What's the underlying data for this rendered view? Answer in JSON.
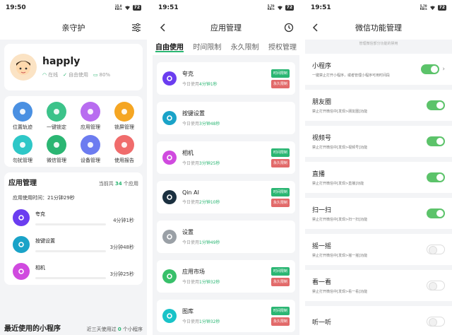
{
  "screen1": {
    "status_time": "19:50",
    "battery": "72",
    "title": "亲守护",
    "profile": {
      "name": "happly",
      "status_online": "在线",
      "status_free": "自由使用",
      "battery_pct": "80%"
    },
    "features": [
      {
        "label": "位置轨迹",
        "color": "#4a90e2"
      },
      {
        "label": "一键锁定",
        "color": "#3cc38a"
      },
      {
        "label": "应用管理",
        "color": "#b86cf0"
      },
      {
        "label": "锁屏管理",
        "color": "#f5a623"
      },
      {
        "label": "勿扰管理",
        "color": "#2ec7c7"
      },
      {
        "label": "微信管理",
        "color": "#2bb673"
      },
      {
        "label": "设备管理",
        "color": "#6c7cf0"
      },
      {
        "label": "使用报告",
        "color": "#f06c6c"
      }
    ],
    "app_section": {
      "title": "应用管理",
      "count_prefix": "当前共",
      "count": "34",
      "count_suffix": "个应用"
    },
    "usage_time": "应用使用时间：21分钟29秒",
    "usage_rows": [
      {
        "name": "夸克",
        "time": "4分钟1秒",
        "color": "#6b3df0"
      },
      {
        "name": "按键设置",
        "time": "3分钟48秒",
        "color": "#1aa3c8"
      },
      {
        "name": "相机",
        "time": "3分钟25秒",
        "color": "#d04adf"
      }
    ],
    "recent": {
      "title": "最近使用的小程序",
      "note_prefix": "近三天使用过",
      "count": "0",
      "note_suffix": "个小程序"
    }
  },
  "screen2": {
    "status_time": "19:51",
    "battery": "72",
    "title": "应用管理",
    "tabs": [
      "自由使用",
      "时间限制",
      "永久限制",
      "授权管理"
    ],
    "buttons": {
      "time_limit": "时间限制",
      "perm_limit": "永久限制"
    },
    "today_prefix": "今日使用",
    "apps": [
      {
        "name": "夸克",
        "use": "4分钟1秒",
        "color": "#6b3df0",
        "btns": true
      },
      {
        "name": "按键设置",
        "use": "3分钟48秒",
        "color": "#1aa3c8",
        "btns": false
      },
      {
        "name": "相机",
        "use": "3分钟25秒",
        "color": "#d04adf",
        "btns": true
      },
      {
        "name": "Qin AI",
        "use": "2分钟10秒",
        "color": "#1b3040",
        "btns": true
      },
      {
        "name": "设置",
        "use": "1分钟49秒",
        "color": "#9aa0a6",
        "btns": false
      },
      {
        "name": "应用市场",
        "use": "1分钟32秒",
        "color": "#38c06a",
        "btns": true
      },
      {
        "name": "图库",
        "use": "1分钟32秒",
        "color": "#19c3c8",
        "btns": true
      }
    ]
  },
  "screen3": {
    "status_time": "19:51",
    "battery": "72",
    "title": "微信功能管理",
    "subtitle": "管理微信部分功能的禁用",
    "features": [
      {
        "name": "小程序",
        "desc": "一键禁止打开小程序，或者管理小程序可用时间段",
        "on": true,
        "chevron": true
      },
      {
        "name": "朋友圈",
        "desc": "禁止打开微信中[发现>朋友圈]功能",
        "on": true,
        "chevron": false
      },
      {
        "name": "视频号",
        "desc": "禁止打开微信中[发现>视频号]功能",
        "on": true,
        "chevron": false
      },
      {
        "name": "直播",
        "desc": "禁止打开微信中[发现>直播]功能",
        "on": true,
        "chevron": false
      },
      {
        "name": "扫一扫",
        "desc": "禁止打开微信中[发现>扫一扫]功能",
        "on": true,
        "chevron": false
      },
      {
        "name": "摇一摇",
        "desc": "禁止打开微信中[发现>摇一摇]功能",
        "on": false,
        "chevron": false
      },
      {
        "name": "看一看",
        "desc": "禁止打开微信中[发现>看一看]功能",
        "on": false,
        "chevron": false
      },
      {
        "name": "听一听",
        "desc": "",
        "on": false,
        "chevron": false
      }
    ]
  }
}
